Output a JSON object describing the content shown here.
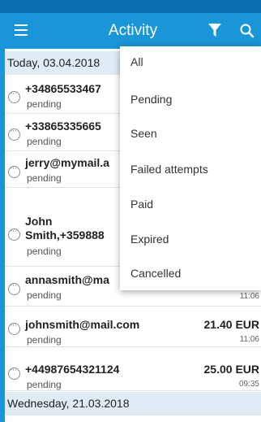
{
  "appbar": {
    "title": "Activity",
    "menu_icon": "hamburger-menu-icon",
    "filter_icon": "filter-funnel-icon",
    "search_icon": "search-icon",
    "color": "#1a95d8"
  },
  "sections": [
    {
      "date": "Today, 03.04.2018",
      "rows": [
        {
          "name": "+34865533467",
          "status": "pending",
          "amount": "",
          "time": ""
        },
        {
          "name": "+33865335665",
          "status": "pending",
          "amount": "",
          "time": ""
        },
        {
          "name": "jerry@mymail.a",
          "status": "pending",
          "amount": "",
          "time": ""
        },
        {
          "name_line1": "John",
          "name_line2": "Smith,+359888",
          "status": "pending",
          "amount": "",
          "time": ""
        },
        {
          "name": "annasmith@ma",
          "status": "pending",
          "amount": "",
          "time": "11:06"
        },
        {
          "name": "johnsmith@mail.com",
          "status": "pending",
          "amount": "21.40 EUR",
          "time": "11:06"
        },
        {
          "name": "+44987654321124",
          "status": "pending",
          "amount": "25.00 EUR",
          "time": "09:35"
        }
      ]
    },
    {
      "date": "Wednesday, 21.03.2018"
    }
  ],
  "filter_menu": {
    "items": [
      "All",
      "Pending",
      "Seen",
      "Failed attempts",
      "Paid",
      "Expired",
      "Cancelled"
    ]
  },
  "status_icon": "pending-dots-circle-icon"
}
